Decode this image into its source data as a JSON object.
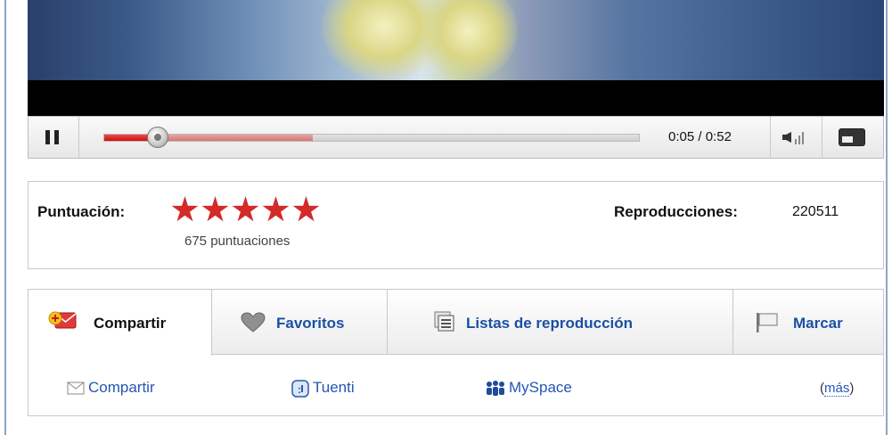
{
  "player": {
    "current_time": "0:05",
    "separator": " / ",
    "duration": "0:52",
    "played_fraction": 0.1,
    "loaded_fraction": 0.39
  },
  "rating": {
    "label": "Puntuación:",
    "stars": 5,
    "count_text": "675 puntuaciones",
    "star_color": "#d42a2a"
  },
  "views": {
    "label": "Reproducciones:",
    "value": "220511"
  },
  "tabs": [
    {
      "label": "Compartir",
      "icon": "mail-plus-icon",
      "active": true
    },
    {
      "label": "Favoritos",
      "icon": "heart-icon",
      "active": false
    },
    {
      "label": "Listas de reproducción",
      "icon": "playlist-icon",
      "active": false
    },
    {
      "label": "Marcar",
      "icon": "flag-icon",
      "active": false
    }
  ],
  "share": {
    "links": [
      {
        "label": "Compartir",
        "icon": "envelope-icon"
      },
      {
        "label": "Tuenti",
        "icon": "tuenti-icon"
      },
      {
        "label": "MySpace",
        "icon": "myspace-icon"
      }
    ],
    "more_open": "(",
    "more_label": "más",
    "more_close": ")"
  },
  "colors": {
    "link": "#2456b3",
    "progress_played": "#cc1010",
    "frame_border": "#8aa9c9"
  }
}
